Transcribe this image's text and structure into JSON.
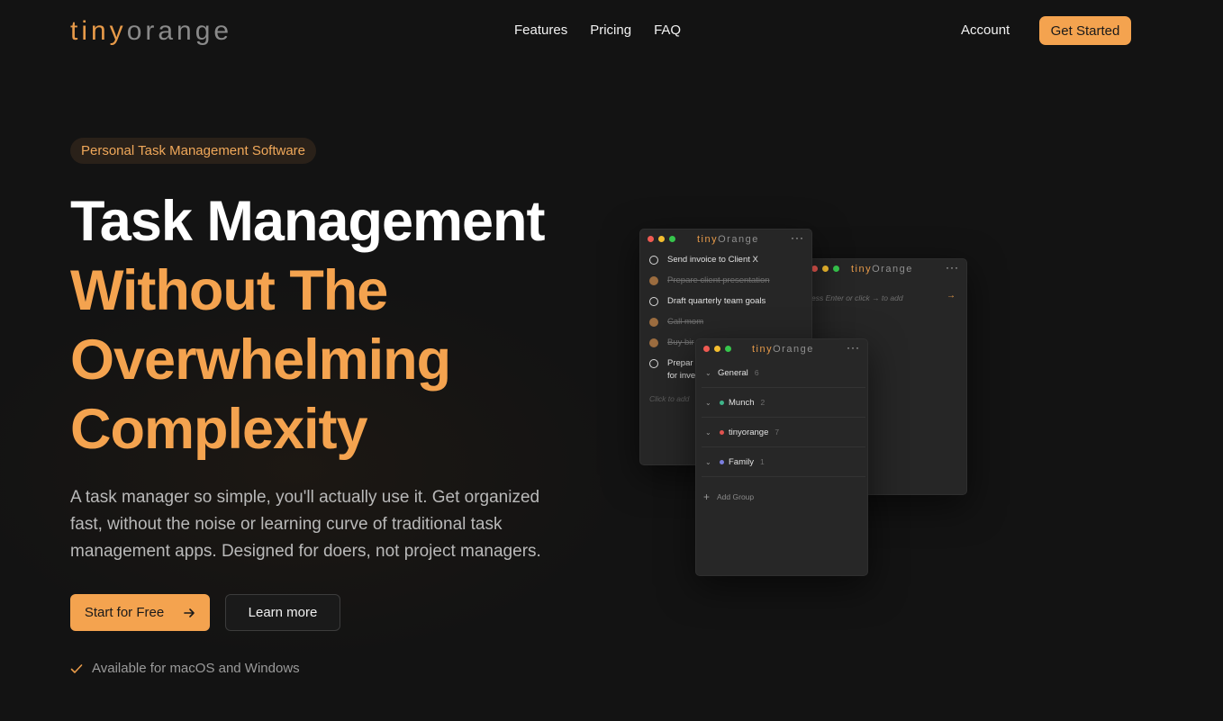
{
  "nav": {
    "logo_part1": "tiny",
    "logo_part2": "orange",
    "links": [
      "Features",
      "Pricing",
      "FAQ"
    ],
    "account": "Account",
    "cta": "Get Started"
  },
  "hero": {
    "pill": "Personal Task Management Software",
    "title_line1": "Task Management",
    "title_line2": "Without The",
    "title_line3": "Overwhelming",
    "title_line4": "Complexity",
    "subtitle": "A task manager so simple, you'll actually use it. Get organized fast, without the noise or learning curve of traditional task management apps. Designed for doers, not project managers.",
    "primary_button": "Start for Free",
    "secondary_button": "Learn more",
    "availability": "Available for macOS and Windows"
  },
  "app": {
    "title_part1": "tiny",
    "title_part2": "Orange",
    "tasks": [
      {
        "text": "Send invoice to Client X",
        "done": false
      },
      {
        "text": "Prepare client presentation",
        "done": true
      },
      {
        "text": "Draft quarterly team goals",
        "done": false
      },
      {
        "text": "Call mom",
        "done": true
      },
      {
        "text": "Buy bir",
        "done": true
      },
      {
        "text": "Prepar",
        "done": false
      },
      {
        "text": "for inve",
        "done": false
      }
    ],
    "click_to_add": "Click to add",
    "enter_hint": "ess Enter or click → to add",
    "groups": [
      {
        "name": "General",
        "count": "6",
        "color": ""
      },
      {
        "name": "Munch",
        "count": "2",
        "color": "#3fb58a"
      },
      {
        "name": "tinyorange",
        "count": "7",
        "color": "#e0524f"
      },
      {
        "name": "Family",
        "count": "1",
        "color": "#7b7fe0"
      }
    ],
    "add_group": "Add Group",
    "colors": {
      "accent": "#f4a34f",
      "background": "#131313"
    }
  }
}
